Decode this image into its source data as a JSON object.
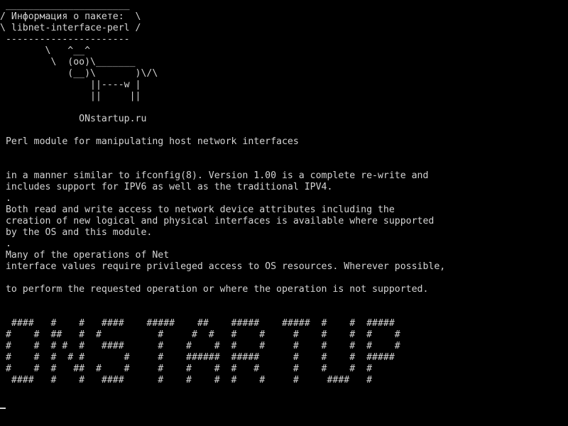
{
  "colors": {
    "background": "#000000",
    "foreground": "#d4d4d4"
  },
  "cowsay": {
    "bubble_top": " ______________________",
    "bubble_line1": "/ Информация о пакете:  \\",
    "bubble_line2": "\\ libnet-interface-perl /",
    "bubble_bottom": " ----------------------",
    "cow_line1": "        \\   ^__^",
    "cow_line2": "         \\  (oo)\\_______",
    "cow_line3": "            (__)\\       )\\/\\",
    "cow_line4": "                ||----w |",
    "cow_line5": "                ||     ||",
    "site": "              ONstartup.ru"
  },
  "description": {
    "summary": " Perl module for manipulating host network interfaces",
    "lines": [
      " in a manner similar to ifconfig(8). Version 1.00 is a complete re-write and",
      " includes support for IPV6 as well as the traditional IPV4.",
      " .",
      " Both read and write access to network device attributes including the",
      " creation of new logical and physical interfaces is available where supported",
      " by the OS and this module.",
      " .",
      " Many of the operations of Net",
      " interface values require privileged access to OS resources. Wherever possible,",
      "",
      " to perform the requested operation or where the operation is not supported."
    ]
  },
  "banner": [
    "  ####   #    #   ####    #####    ##    #####    #####  #    #  #####",
    " #    #  ##   #  #          #     #  #   #    #     #    #    #  #    #",
    " #    #  # #  #   ####      #    #    #  #    #     #    #    #  #    #",
    " #    #  #  # #       #     #    ######  #####      #    #    #  #####",
    " #    #  #   ##  #    #     #    #    #  #   #      #    #    #  #",
    "  ####   #    #   ####      #    #    #  #    #     #     ####   #"
  ]
}
